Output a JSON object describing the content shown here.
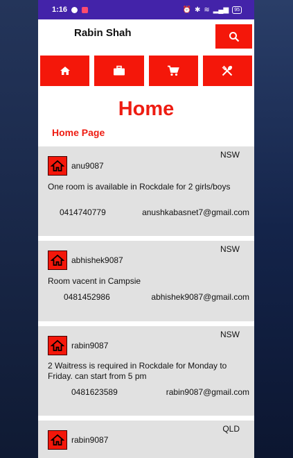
{
  "status_bar": {
    "time": "1:16",
    "battery": "95"
  },
  "header": {
    "user_name": "Rabin Shah"
  },
  "nav": [
    "home-icon",
    "briefcase-icon",
    "cart-icon",
    "restaurant-icon"
  ],
  "page": {
    "title": "Home",
    "subtitle": "Home Page"
  },
  "posts": [
    {
      "state": "NSW",
      "username": "anu9087",
      "text": "One room is available in Rockdale for 2 girls/boys",
      "phone": "0414740779",
      "email": "anushkabasnet7@gmail.com"
    },
    {
      "state": "NSW",
      "username": "abhishek9087",
      "text": "Room vacent in Campsie",
      "phone": "0481452986",
      "email": "abhishek9087@gmail.com"
    },
    {
      "state": "NSW",
      "username": "rabin9087",
      "text": "2 Waitress is required in Rockdale for Monday to Friday. can start from 5 pm",
      "phone": "0481623589",
      "email": "rabin9087@gmail.com"
    },
    {
      "state": "QLD",
      "username": "rabin9087"
    }
  ],
  "colors": {
    "accent": "#f4170a",
    "status_bar": "#4323a9",
    "card_bg": "#e1e1e1"
  }
}
